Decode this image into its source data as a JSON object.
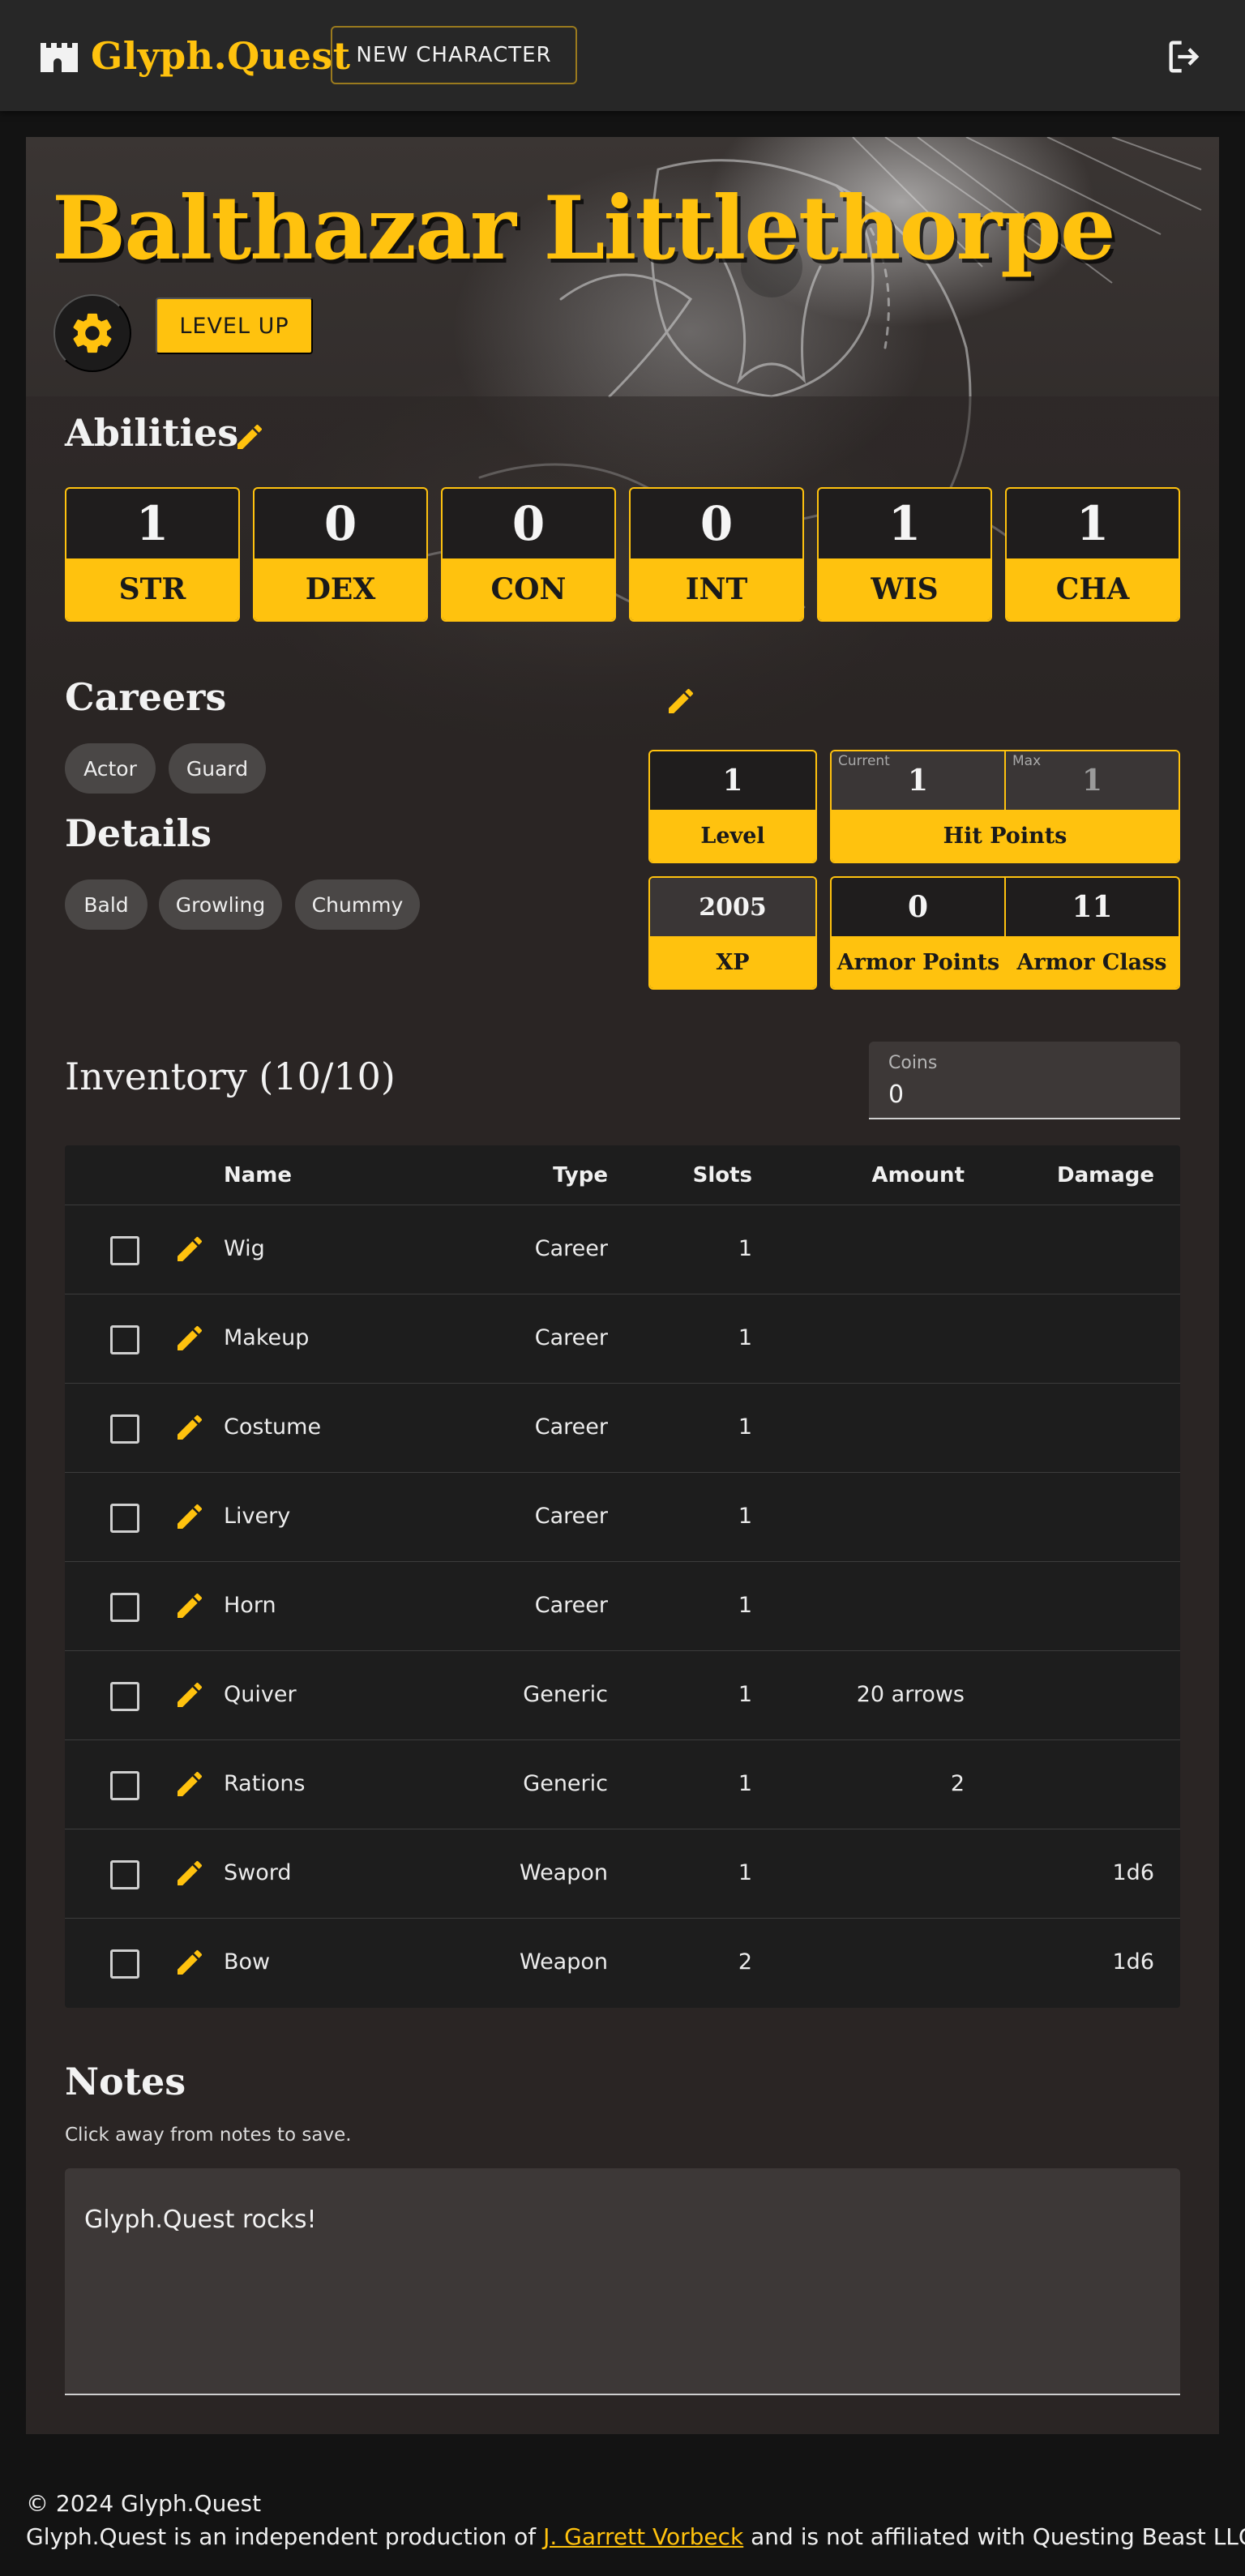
{
  "app": {
    "name": "Glyph.Quest",
    "new_character_label": "NEW CHARACTER"
  },
  "character": {
    "name": "Balthazar Littlethorpe",
    "level_up_label": "LEVEL UP"
  },
  "abilities": {
    "title": "Abilities",
    "items": [
      {
        "label": "STR",
        "value": "1"
      },
      {
        "label": "DEX",
        "value": "0"
      },
      {
        "label": "CON",
        "value": "0"
      },
      {
        "label": "INT",
        "value": "0"
      },
      {
        "label": "WIS",
        "value": "1"
      },
      {
        "label": "CHA",
        "value": "1"
      }
    ]
  },
  "careers": {
    "title": "Careers",
    "items": [
      "Actor",
      "Guard"
    ]
  },
  "details": {
    "title": "Details",
    "items": [
      "Bald",
      "Growling",
      "Chummy"
    ]
  },
  "stats": {
    "level": {
      "label": "Level",
      "value": "1"
    },
    "hit_points": {
      "label": "Hit Points",
      "current_label": "Current",
      "current": "1",
      "max_label": "Max",
      "max": "1"
    },
    "xp": {
      "label": "XP",
      "value": "2005"
    },
    "armor_points": {
      "label": "Armor Points",
      "value": "0"
    },
    "armor_class": {
      "label": "Armor Class",
      "value": "11"
    }
  },
  "inventory": {
    "title": "Inventory (10/10)",
    "coins_label": "Coins",
    "coins_value": "0",
    "columns": {
      "name": "Name",
      "type": "Type",
      "slots": "Slots",
      "amount": "Amount",
      "damage": "Damage"
    },
    "rows": [
      {
        "name": "Wig",
        "type": "Career",
        "slots": "1",
        "amount": "",
        "damage": ""
      },
      {
        "name": "Makeup",
        "type": "Career",
        "slots": "1",
        "amount": "",
        "damage": ""
      },
      {
        "name": "Costume",
        "type": "Career",
        "slots": "1",
        "amount": "",
        "damage": ""
      },
      {
        "name": "Livery",
        "type": "Career",
        "slots": "1",
        "amount": "",
        "damage": ""
      },
      {
        "name": "Horn",
        "type": "Career",
        "slots": "1",
        "amount": "",
        "damage": ""
      },
      {
        "name": "Quiver",
        "type": "Generic",
        "slots": "1",
        "amount": "20 arrows",
        "damage": ""
      },
      {
        "name": "Rations",
        "type": "Generic",
        "slots": "1",
        "amount": "2",
        "damage": ""
      },
      {
        "name": "Sword",
        "type": "Weapon",
        "slots": "1",
        "amount": "",
        "damage": "1d6"
      },
      {
        "name": "Bow",
        "type": "Weapon",
        "slots": "2",
        "amount": "",
        "damage": "1d6"
      }
    ]
  },
  "notes": {
    "title": "Notes",
    "hint": "Click away from notes to save.",
    "content": "Glyph.Quest rocks!"
  },
  "footer": {
    "copyright": "© 2024 Glyph.Quest",
    "line_before": "Glyph.Quest is an independent production of ",
    "author_link": "J. Garrett Vorbeck",
    "line_after": " and is not affiliated with Questing Beast LLC."
  },
  "colors": {
    "accent": "#ffc20e",
    "background": "#131313",
    "card": "#2a2524",
    "topbar": "#272727"
  },
  "icons": [
    "castle-icon",
    "logout-icon",
    "gear-icon",
    "pencil-icon"
  ]
}
